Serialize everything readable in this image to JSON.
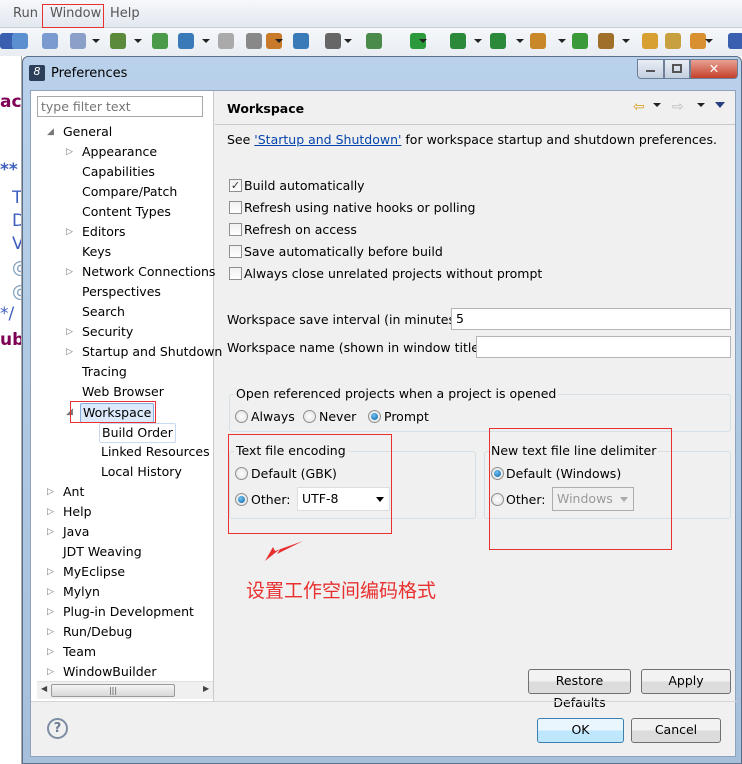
{
  "menubar": {
    "items": [
      "Run",
      "Window",
      "Help"
    ]
  },
  "editor": {
    "chars": [
      "ac",
      "**",
      "T",
      "D",
      "V",
      "@",
      "@",
      "*/",
      "ub"
    ]
  },
  "dialog": {
    "title": "Preferences",
    "filter_placeholder": "type filter text",
    "tree": [
      {
        "label": "General",
        "level": 0,
        "state": "expanded"
      },
      {
        "label": "Appearance",
        "level": 1,
        "state": "collapsed"
      },
      {
        "label": "Capabilities",
        "level": 1,
        "state": "leaf"
      },
      {
        "label": "Compare/Patch",
        "level": 1,
        "state": "leaf"
      },
      {
        "label": "Content Types",
        "level": 1,
        "state": "leaf"
      },
      {
        "label": "Editors",
        "level": 1,
        "state": "collapsed"
      },
      {
        "label": "Keys",
        "level": 1,
        "state": "leaf"
      },
      {
        "label": "Network Connections",
        "level": 1,
        "state": "collapsed"
      },
      {
        "label": "Perspectives",
        "level": 1,
        "state": "leaf"
      },
      {
        "label": "Search",
        "level": 1,
        "state": "leaf"
      },
      {
        "label": "Security",
        "level": 1,
        "state": "collapsed"
      },
      {
        "label": "Startup and Shutdown",
        "level": 1,
        "state": "collapsed"
      },
      {
        "label": "Tracing",
        "level": 1,
        "state": "leaf"
      },
      {
        "label": "Web Browser",
        "level": 1,
        "state": "leaf"
      },
      {
        "label": "Workspace",
        "level": 1,
        "state": "expanded",
        "selected": true
      },
      {
        "label": "Build Order",
        "level": 2,
        "state": "leaf"
      },
      {
        "label": "Linked Resources",
        "level": 2,
        "state": "leaf"
      },
      {
        "label": "Local History",
        "level": 2,
        "state": "leaf"
      },
      {
        "label": "Ant",
        "level": 0,
        "state": "collapsed"
      },
      {
        "label": "Help",
        "level": 0,
        "state": "collapsed"
      },
      {
        "label": "Java",
        "level": 0,
        "state": "collapsed"
      },
      {
        "label": "JDT Weaving",
        "level": 0,
        "state": "leaf"
      },
      {
        "label": "MyEclipse",
        "level": 0,
        "state": "collapsed"
      },
      {
        "label": "Mylyn",
        "level": 0,
        "state": "collapsed"
      },
      {
        "label": "Plug-in Development",
        "level": 0,
        "state": "collapsed"
      },
      {
        "label": "Run/Debug",
        "level": 0,
        "state": "collapsed"
      },
      {
        "label": "Team",
        "level": 0,
        "state": "collapsed"
      },
      {
        "label": "WindowBuilder",
        "level": 0,
        "state": "collapsed"
      }
    ],
    "page": {
      "heading": "Workspace",
      "see_prefix": "See ",
      "see_link": "'Startup and Shutdown'",
      "see_suffix": " for workspace startup and shutdown preferences.",
      "checkboxes": [
        {
          "label": "Build automatically",
          "checked": true
        },
        {
          "label": "Refresh using native hooks or polling",
          "checked": false
        },
        {
          "label": "Refresh on access",
          "checked": false
        },
        {
          "label": "Save automatically before build",
          "checked": false
        },
        {
          "label": "Always close unrelated projects without prompt",
          "checked": false
        }
      ],
      "save_interval_label": "Workspace save interval (in minutes):",
      "save_interval_value": "5",
      "workspace_name_label": "Workspace name (shown in window title):",
      "workspace_name_value": "",
      "open_ref": {
        "title": "Open referenced projects when a project is opened",
        "options": [
          "Always",
          "Never",
          "Prompt"
        ],
        "selected": "Prompt"
      },
      "encoding": {
        "title": "Text file encoding",
        "default_label": "Default (GBK)",
        "other_label": "Other:",
        "other_value": "UTF-8",
        "selected": "Other"
      },
      "delimiter": {
        "title": "New text file line delimiter",
        "default_label": "Default (Windows)",
        "other_label": "Other:",
        "other_value": "Windows",
        "selected": "Default"
      },
      "annotation": "设置工作空间编码格式",
      "restore_label": "Restore Defaults",
      "apply_label": "Apply"
    },
    "ok_label": "OK",
    "cancel_label": "Cancel"
  },
  "colors": {
    "annotation": "#e83030",
    "link": "#0645ad",
    "selection": "#dceafc"
  }
}
